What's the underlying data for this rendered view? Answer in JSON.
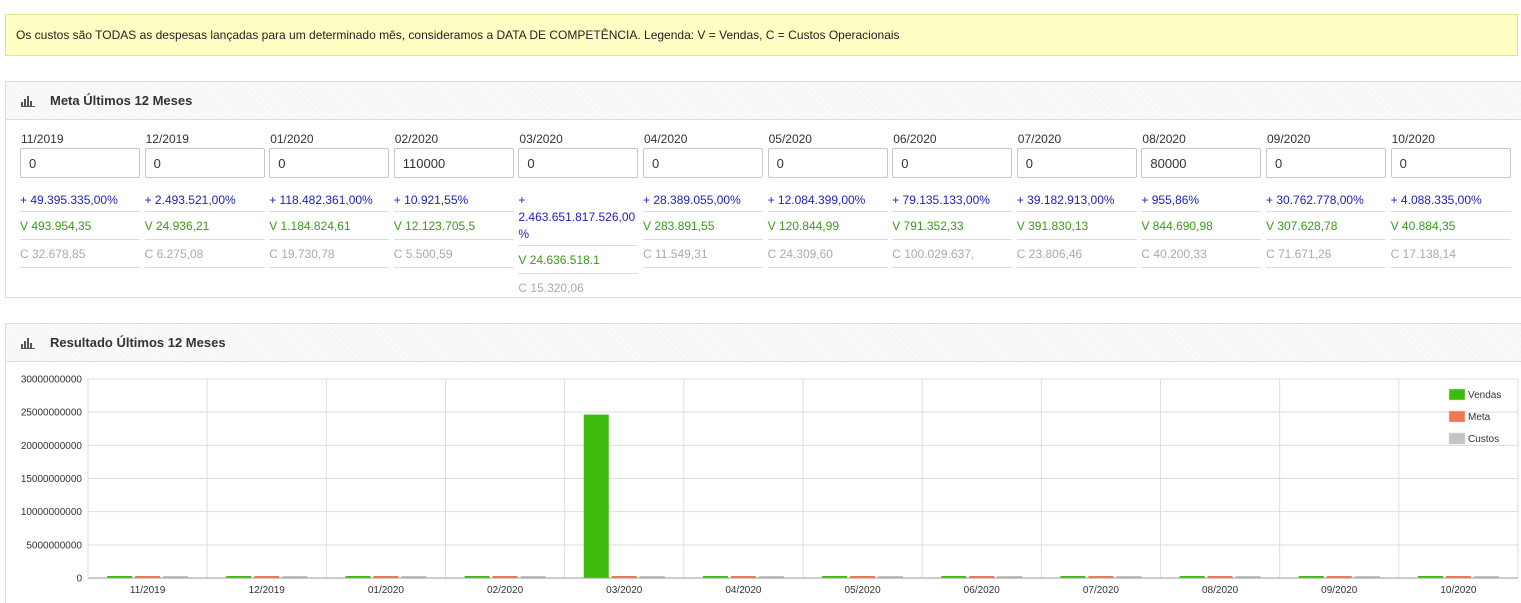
{
  "notice": "Os custos são TODAS as despesas lançadas para um determinado mês, consideramos a DATA DE COMPETÊNCIA. Legenda: V = Vendas, C = Custos Operacionais",
  "meta_panel": {
    "title": "Meta Últimos 12 Meses",
    "months": [
      {
        "label": "11/2019",
        "meta": "0",
        "pct": "+ 49.395.335,00%",
        "vendas": "V 493.954,35",
        "custos": "C 32.678,85"
      },
      {
        "label": "12/2019",
        "meta": "0",
        "pct": "+ 2.493.521,00%",
        "vendas": "V 24.936,21",
        "custos": "C 6.275,08"
      },
      {
        "label": "01/2020",
        "meta": "0",
        "pct": "+ 118.482.361,00%",
        "vendas": "V 1.184.824,61",
        "custos": "C 19.730,78"
      },
      {
        "label": "02/2020",
        "meta": "110000",
        "pct": "+ 10.921,55%",
        "vendas": "V 12.123.705,5",
        "custos": "C 5.500,59"
      },
      {
        "label": "03/2020",
        "meta": "0",
        "pct": "+ 2.463.651.817.526,00%",
        "vendas": "V 24.636.518.1",
        "custos": "C 15.320,06"
      },
      {
        "label": "04/2020",
        "meta": "0",
        "pct": "+ 28.389.055,00%",
        "vendas": "V 283.891,55",
        "custos": "C 11.549,31"
      },
      {
        "label": "05/2020",
        "meta": "0",
        "pct": "+ 12.084.399,00%",
        "vendas": "V 120.844,99",
        "custos": "C 24.309,60"
      },
      {
        "label": "06/2020",
        "meta": "0",
        "pct": "+ 79.135.133,00%",
        "vendas": "V 791.352,33",
        "custos": "C 100.029.637,"
      },
      {
        "label": "07/2020",
        "meta": "0",
        "pct": "+ 39.182.913,00%",
        "vendas": "V 391.830,13",
        "custos": "C 23.806,46"
      },
      {
        "label": "08/2020",
        "meta": "80000",
        "pct": "+ 955,86%",
        "vendas": "V 844.690,98",
        "custos": "C 40.200,33"
      },
      {
        "label": "09/2020",
        "meta": "0",
        "pct": "+ 30.762.778,00%",
        "vendas": "V 307.628,78",
        "custos": "C 71.671,26"
      },
      {
        "label": "10/2020",
        "meta": "0",
        "pct": "+ 4.088.335,00%",
        "vendas": "V 40.884,35",
        "custos": "C 17.138,14"
      }
    ]
  },
  "chart_panel": {
    "title": "Resultado Últimos 12 Meses"
  },
  "chart_data": {
    "type": "bar",
    "categories": [
      "11/2019",
      "12/2019",
      "01/2020",
      "02/2020",
      "03/2020",
      "04/2020",
      "05/2020",
      "06/2020",
      "07/2020",
      "08/2020",
      "09/2020",
      "10/2020"
    ],
    "ylim": [
      0,
      30000000000
    ],
    "yticks": [
      0,
      5000000000,
      10000000000,
      15000000000,
      20000000000,
      25000000000,
      30000000000
    ],
    "grid": true,
    "legend_position": "top-right",
    "series": [
      {
        "name": "Vendas",
        "color": "#3cbc0c",
        "values": [
          493954.35,
          24936.21,
          1184824.61,
          12123705.5,
          24636518100,
          283891.55,
          120844.99,
          791352.33,
          391830.13,
          844690.98,
          307628.78,
          40884.35
        ]
      },
      {
        "name": "Meta",
        "color": "#f07850",
        "values": [
          0,
          0,
          0,
          110000,
          0,
          0,
          0,
          0,
          0,
          80000,
          0,
          0
        ]
      },
      {
        "name": "Custos",
        "color": "#c4c4c4",
        "values": [
          32678.85,
          6275.08,
          19730.78,
          5500.59,
          15320.06,
          11549.31,
          24309.6,
          100029637,
          23806.46,
          40200.33,
          71671.26,
          17138.14
        ]
      }
    ]
  },
  "colors": {
    "notice_bg": "#ffffc4",
    "pct": "#2020c0",
    "vendas": "#3a9a1a",
    "custos": "#aaaaaa"
  }
}
